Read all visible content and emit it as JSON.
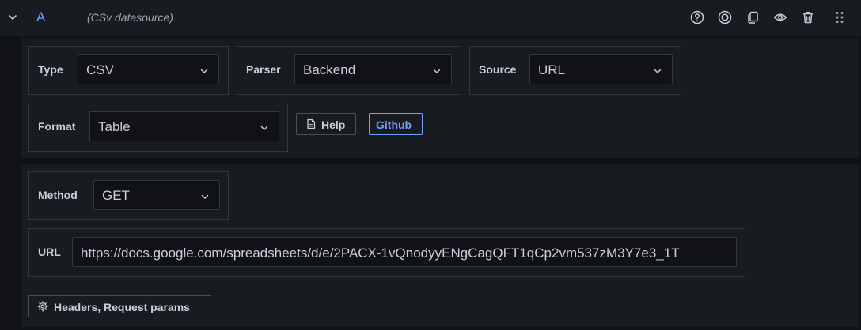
{
  "query": {
    "letter": "A",
    "datasource_name": "(CSv datasource)"
  },
  "header_icons": [
    "chevron-down-icon",
    "help-icon",
    "inspector-icon",
    "duplicate-icon",
    "eye-icon",
    "trash-icon",
    "drag-handle-icon"
  ],
  "settings": {
    "type": {
      "label": "Type",
      "value": "CSV"
    },
    "parser": {
      "label": "Parser",
      "value": "Backend"
    },
    "source": {
      "label": "Source",
      "value": "URL"
    },
    "format": {
      "label": "Format",
      "value": "Table"
    },
    "help_button": "Help",
    "github_button": "Github"
  },
  "request": {
    "method": {
      "label": "Method",
      "value": "GET"
    },
    "url": {
      "label": "URL",
      "value": "https://docs.google.com/spreadsheets/d/e/2PACX-1vQnodyyENgCagQFT1qCp2vm537zM3Y7e3_1T"
    },
    "headers_button": "Headers, Request params"
  },
  "colors": {
    "accent": "#6e9fff",
    "background": "#111217",
    "panel": "#181b1f",
    "border": "#34373d"
  }
}
